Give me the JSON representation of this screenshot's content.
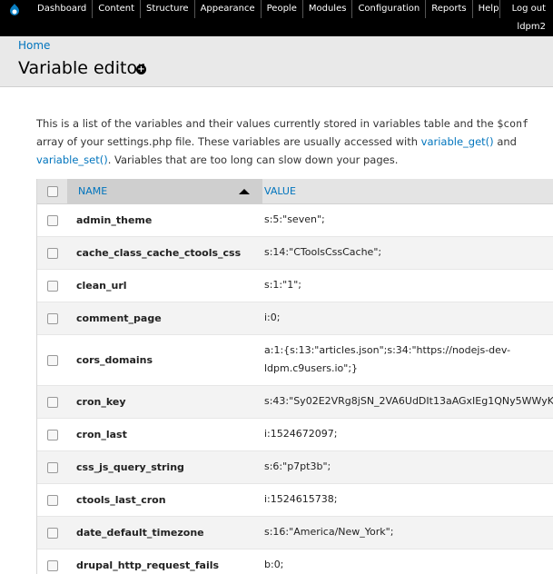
{
  "toolbar": {
    "menu": [
      "Dashboard",
      "Content",
      "Structure",
      "Appearance",
      "People",
      "Modules",
      "Configuration",
      "Reports",
      "Help"
    ],
    "logout": "Log out",
    "user": "ldpm2"
  },
  "header": {
    "breadcrumb": "Home",
    "title": "Variable editor"
  },
  "intro": {
    "t1": "This is a list of the variables and their values currently stored in variables table and the ",
    "code": "$conf",
    "t2": " array of your settings.php file. These variables are usually accessed with ",
    "link1": "variable_get()",
    "t3": " and ",
    "link2": "variable_set()",
    "t4": ". Variables that are too long can slow down your pages."
  },
  "table": {
    "headers": {
      "name": "NAME",
      "value": "VALUE"
    },
    "rows": [
      {
        "name": "admin_theme",
        "value": "s:5:\"seven\";"
      },
      {
        "name": "cache_class_cache_ctools_css",
        "value": "s:14:\"CToolsCssCache\";"
      },
      {
        "name": "clean_url",
        "value": "s:1:\"1\";"
      },
      {
        "name": "comment_page",
        "value": "i:0;"
      },
      {
        "name": "cors_domains",
        "value_line1": "a:1:{s:13:\"articles.json\";s:34:\"https://nodejs-dev-",
        "value_line2": "ldpm.c9users.io\";}"
      },
      {
        "name": "cron_key",
        "value": "s:43:\"Sy02E2VRg8jSN_2VA6UdDIt13aAGxIEg1QNy5WWyK"
      },
      {
        "name": "cron_last",
        "value": "i:1524672097;"
      },
      {
        "name": "css_js_query_string",
        "value": "s:6:\"p7pt3b\";"
      },
      {
        "name": "ctools_last_cron",
        "value": "i:1524615738;"
      },
      {
        "name": "date_default_timezone",
        "value": "s:16:\"America/New_York\";"
      },
      {
        "name": "drupal_http_request_fails",
        "value": "b:0;"
      }
    ]
  }
}
